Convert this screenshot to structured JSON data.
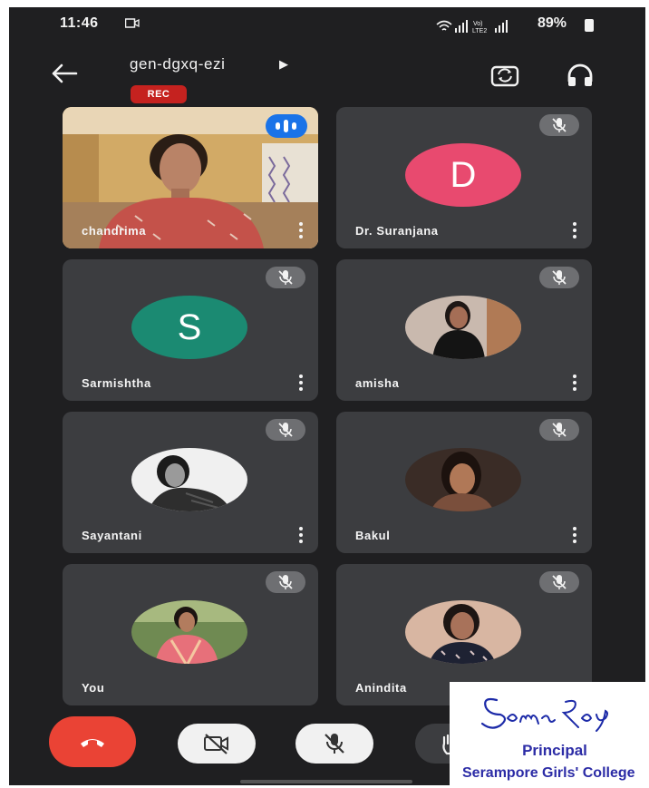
{
  "status_bar": {
    "time": "11:46",
    "battery": "89%",
    "network": "Vo) LTE2"
  },
  "header": {
    "meeting_code": "gen-dgxq-ezi",
    "recording_badge": "REC",
    "icons": [
      "back-arrow-icon",
      "switch-camera-icon",
      "headphones-icon"
    ]
  },
  "participants": [
    {
      "name": "chandrima",
      "state": "video",
      "speaking": true
    },
    {
      "name": "Dr. Suranjana",
      "avatar_letter": "D",
      "avatar_color": "#e84a6f",
      "muted": true
    },
    {
      "name": "Sarmishtha",
      "avatar_letter": "S",
      "avatar_color": "#1b8a72",
      "muted": true
    },
    {
      "name": "amisha",
      "avatar": "photo",
      "muted": true
    },
    {
      "name": "Sayantani",
      "avatar": "photo",
      "muted": true
    },
    {
      "name": "Bakul",
      "avatar": "photo",
      "muted": true
    },
    {
      "name": "You",
      "avatar": "photo",
      "muted": true
    },
    {
      "name": "Anindita",
      "avatar": "photo",
      "muted": true
    }
  ],
  "controls": {
    "items": [
      "end-call-icon",
      "camera-off-icon",
      "mic-off-icon",
      "raise-hand-icon"
    ],
    "end_call_color": "#ea4335"
  },
  "seal": {
    "signature": "Soma Roy",
    "title": "Principal",
    "organization": "Serampore Girls' College"
  }
}
